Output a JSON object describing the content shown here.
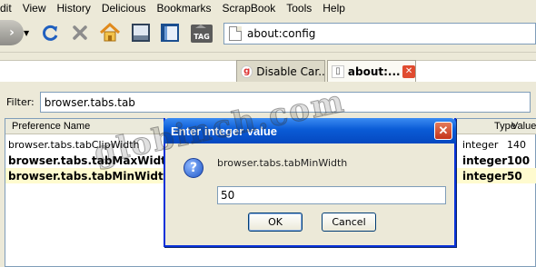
{
  "menu": [
    "dit",
    "View",
    "History",
    "Delicious",
    "Bookmarks",
    "ScrapBook",
    "Tools",
    "Help"
  ],
  "toolbar": {
    "back_icon": "back-arrow-icon",
    "reload_icon": "reload-icon",
    "stop_icon": "stop-icon",
    "home_icon": "home-icon",
    "scrapbook_icon": "scrapbook-icon",
    "bookmark_icon": "bookmark-icon",
    "tag_label": "TAG",
    "url": "about:config"
  },
  "tabs": [
    {
      "favicon_letter": "g",
      "label": "Disable Car..."
    },
    {
      "label": "about:...",
      "close_glyph": "✕"
    }
  ],
  "filter": {
    "label": "Filter:",
    "value": "browser.tabs.tab"
  },
  "table": {
    "columns": {
      "name": "Preference Name",
      "type": "Type",
      "value": "Value"
    },
    "rows": [
      {
        "name": "browser.tabs.tabClipWidth",
        "type": "integer",
        "value": "140",
        "modified": false
      },
      {
        "name": "browser.tabs.tabMaxWidth",
        "type": "integer",
        "value": "100",
        "modified": true
      },
      {
        "name": "browser.tabs.tabMinWidth",
        "type": "integer",
        "value": "50",
        "modified": true
      }
    ]
  },
  "dialog": {
    "title": "Enter integer value",
    "close_glyph": "✕",
    "message": "browser.tabs.tabMinWidth",
    "input_value": "50",
    "ok_label": "OK",
    "cancel_label": "Cancel"
  },
  "watermark": "globinch.com",
  "colors": {
    "dialog_title": "#0a5bd6",
    "tab_close": "#e04b2f",
    "selected_row": "#fffbcf"
  }
}
